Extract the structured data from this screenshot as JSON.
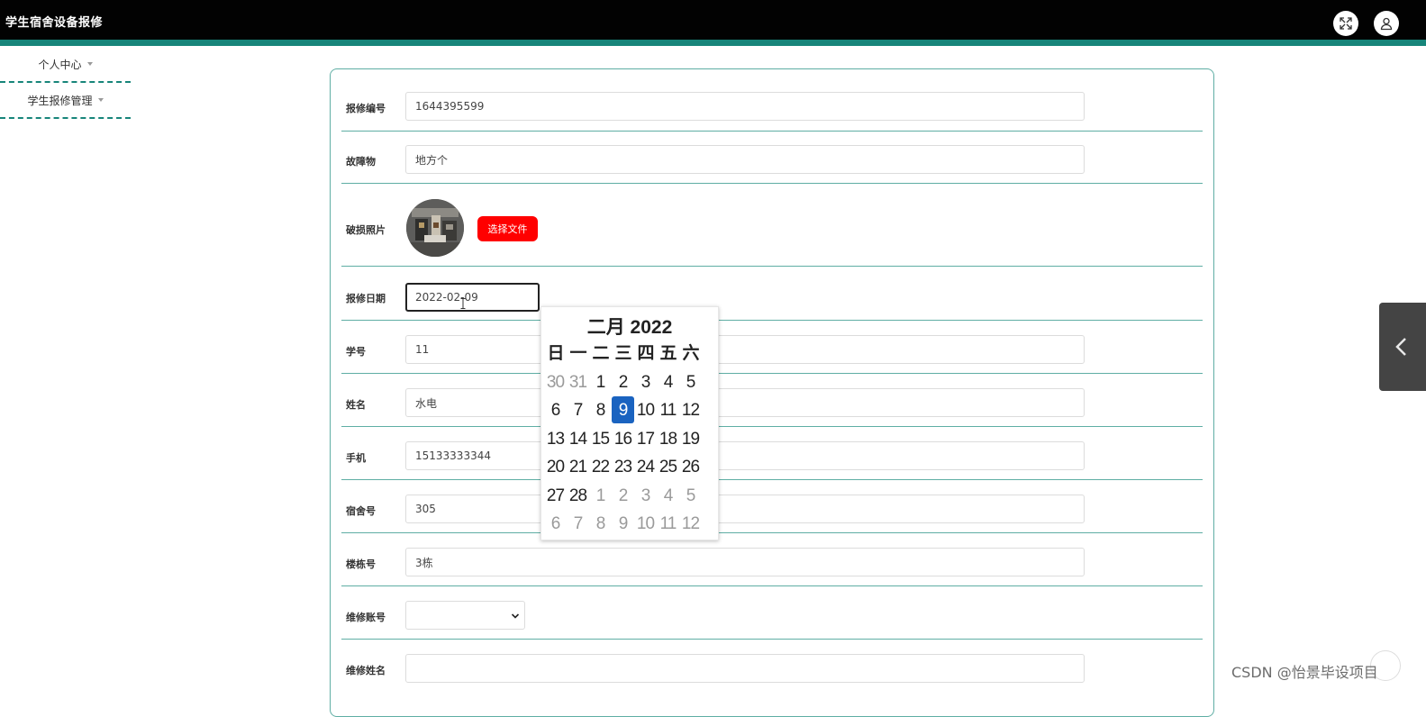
{
  "header": {
    "app_title": "学生宿舍设备报修",
    "fullscreen_icon": "expand-icon",
    "user_icon": "user-icon"
  },
  "sidebar": {
    "items": [
      {
        "label": "个人中心"
      },
      {
        "label": "学生报修管理"
      }
    ]
  },
  "form": {
    "repair_no": {
      "label": "报修编号",
      "value": "1644395599"
    },
    "faulty_item": {
      "label": "故障物",
      "value": "地方个"
    },
    "damage_photo": {
      "label": "破损照片",
      "button": "选择文件"
    },
    "repair_date": {
      "label": "报修日期",
      "value": "2022-02-09"
    },
    "student_id": {
      "label": "学号",
      "value": "11"
    },
    "name": {
      "label": "姓名",
      "value": "水电"
    },
    "phone": {
      "label": "手机",
      "value": "15133333344"
    },
    "dorm_no": {
      "label": "宿舍号",
      "value": "305"
    },
    "building_no": {
      "label": "楼栋号",
      "value": "3栋"
    },
    "maint_account": {
      "label": "维修账号",
      "value": ""
    },
    "maint_name": {
      "label": "维修姓名",
      "value": ""
    }
  },
  "datepicker": {
    "title": "二月 2022",
    "weekdays": [
      "日",
      "一",
      "二",
      "三",
      "四",
      "五",
      "六"
    ],
    "selected": 9,
    "weeks": [
      [
        {
          "d": "30",
          "m": true
        },
        {
          "d": "31",
          "m": true
        },
        {
          "d": "1"
        },
        {
          "d": "2"
        },
        {
          "d": "3"
        },
        {
          "d": "4"
        },
        {
          "d": "5"
        }
      ],
      [
        {
          "d": "6"
        },
        {
          "d": "7"
        },
        {
          "d": "8"
        },
        {
          "d": "9",
          "s": true
        },
        {
          "d": "10"
        },
        {
          "d": "11"
        },
        {
          "d": "12"
        }
      ],
      [
        {
          "d": "13"
        },
        {
          "d": "14"
        },
        {
          "d": "15"
        },
        {
          "d": "16"
        },
        {
          "d": "17"
        },
        {
          "d": "18"
        },
        {
          "d": "19"
        }
      ],
      [
        {
          "d": "20"
        },
        {
          "d": "21"
        },
        {
          "d": "22"
        },
        {
          "d": "23"
        },
        {
          "d": "24"
        },
        {
          "d": "25"
        },
        {
          "d": "26"
        }
      ],
      [
        {
          "d": "27"
        },
        {
          "d": "28"
        },
        {
          "d": "1",
          "m": true
        },
        {
          "d": "2",
          "m": true
        },
        {
          "d": "3",
          "m": true
        },
        {
          "d": "4",
          "m": true
        },
        {
          "d": "5",
          "m": true
        }
      ],
      [
        {
          "d": "6",
          "m": true
        },
        {
          "d": "7",
          "m": true
        },
        {
          "d": "8",
          "m": true
        },
        {
          "d": "9",
          "m": true
        },
        {
          "d": "10",
          "m": true
        },
        {
          "d": "11",
          "m": true
        },
        {
          "d": "12",
          "m": true
        }
      ]
    ]
  },
  "watermark": "CSDN @怡景毕设项目",
  "colors": {
    "header_bg": "#020202",
    "accent_teal": "#17857a",
    "choose_button": "#ff0000",
    "selected_day": "#1a63c0"
  }
}
